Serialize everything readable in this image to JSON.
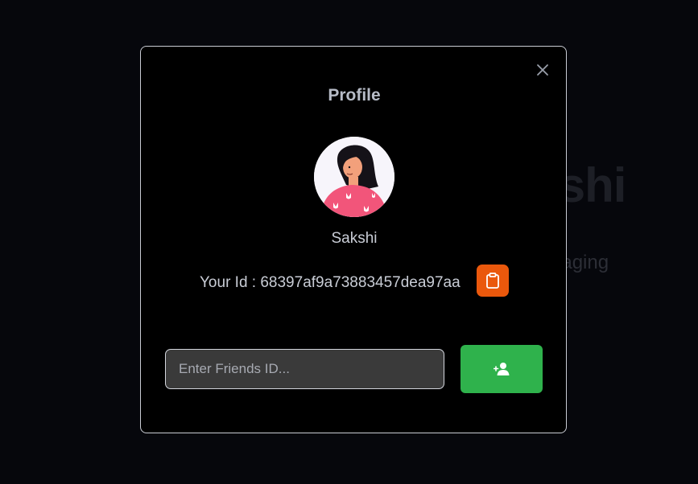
{
  "background": {
    "title": "Sakshi",
    "subtitle": "Messaging"
  },
  "modal": {
    "title": "Profile",
    "user_name": "Sakshi",
    "id_label": "Your Id : ",
    "id_value": "68397af9a73883457dea97aa",
    "copy_icon": "clipboard-icon",
    "close_icon": "close-icon",
    "friend_input": {
      "value": "",
      "placeholder": "Enter Friends ID..."
    },
    "add_icon": "add-user-icon",
    "colors": {
      "copy_button": "#ea580c",
      "add_button": "#2fb24c",
      "avatar_shirt": "#f2557a"
    }
  }
}
